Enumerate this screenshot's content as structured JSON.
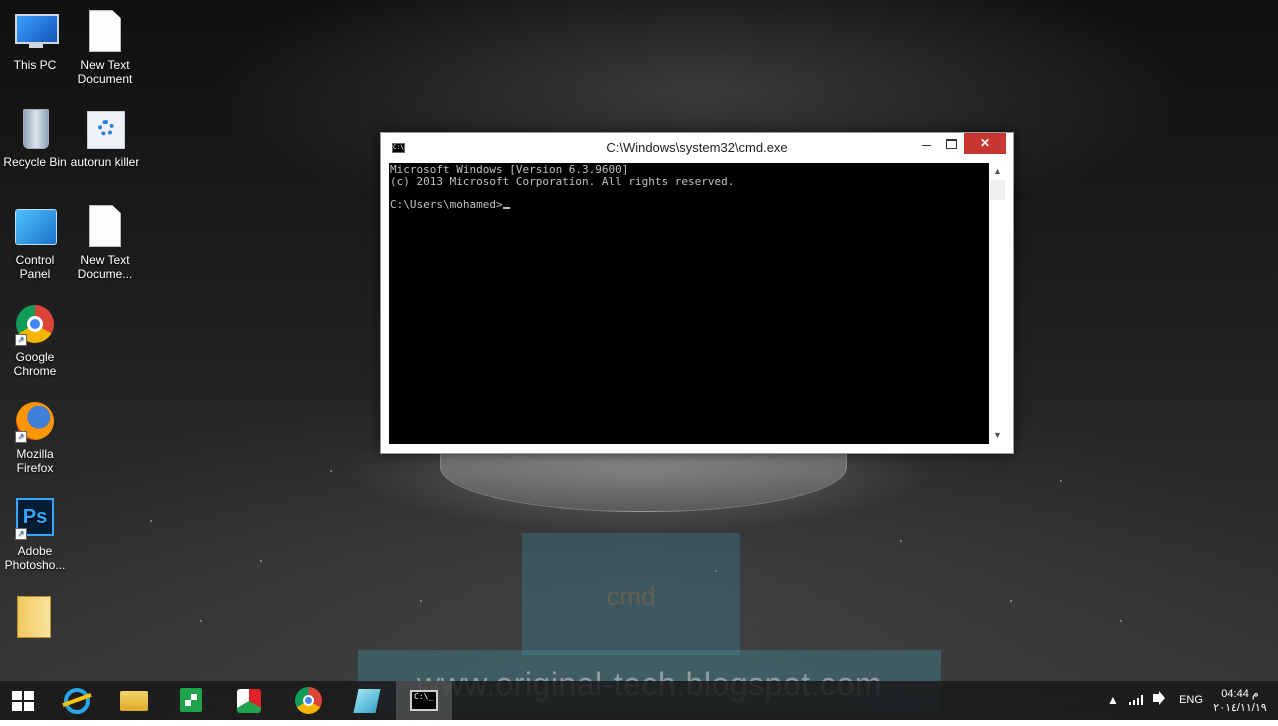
{
  "desktop": {
    "icons": [
      {
        "label": "This PC",
        "icon": "computer-icon"
      },
      {
        "label": "New Text\nDocument",
        "icon": "text-document-icon"
      },
      {
        "label": "Recycle Bin",
        "icon": "recycle-bin-icon"
      },
      {
        "label": "autorun killer",
        "icon": "autorun-killer-icon"
      },
      {
        "label": "Control\nPanel",
        "icon": "control-panel-icon"
      },
      {
        "label": "New Text\nDocume...",
        "icon": "text-document-icon"
      },
      {
        "label": "Google\nChrome",
        "icon": "chrome-icon"
      },
      {
        "label": "Mozilla\nFirefox",
        "icon": "firefox-icon"
      },
      {
        "label": "Adobe\nPhotosho...",
        "icon": "photoshop-icon"
      },
      {
        "label": "",
        "icon": "folder-icon"
      }
    ],
    "ps_glyph": "Ps"
  },
  "cmd": {
    "title": "C:\\Windows\\system32\\cmd.exe",
    "close_glyph": "✕",
    "icon_glyph": "C:\\",
    "lines": [
      "Microsoft Windows [Version 6.3.9600]",
      "(c) 2013 Microsoft Corporation. All rights reserved.",
      "",
      "C:\\Users\\mohamed>"
    ],
    "scroll_up_glyph": "▲",
    "scroll_down_glyph": "▼"
  },
  "overlay": {
    "search_text": "cmd",
    "watermark": "www.original-tech.blogspot.com"
  },
  "taskbar": {
    "items": [
      "start-icon",
      "internet-explorer-icon",
      "file-explorer-icon",
      "store-icon",
      "office-icon",
      "chrome-icon",
      "remote-desktop-icon",
      "command-prompt-icon"
    ],
    "active_item": "command-prompt-icon",
    "cmd_glyph": "C:\\_",
    "tray": {
      "chevron": "▲",
      "language": "ENG",
      "time": "04:44 م",
      "date": "٢٠١٤/١١/١٩"
    }
  }
}
